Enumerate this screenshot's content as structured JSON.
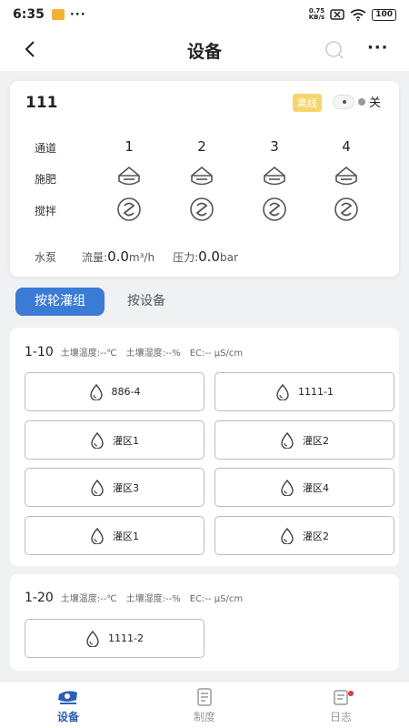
{
  "status_bar": {
    "time": "6:35",
    "dots": "···",
    "net_speed_value": "0.75",
    "net_speed_unit": "KB/s",
    "battery": "100"
  },
  "navbar": {
    "title": "设备"
  },
  "device": {
    "name": "111",
    "status_badge": "离线",
    "switch_label": "关",
    "row_labels": {
      "channel": "通道",
      "fertilize": "施肥",
      "stir": "搅拌",
      "pump": "水泵"
    },
    "channels": [
      "1",
      "2",
      "3",
      "4"
    ],
    "pump": {
      "flow_label": "流量:",
      "flow_value": "0.0",
      "flow_unit": "m³/h",
      "pressure_label": "压力:",
      "pressure_value": "0.0",
      "pressure_unit": "bar"
    }
  },
  "tabs": {
    "by_group": "按轮灌组",
    "by_device": "按设备",
    "active": "by_group"
  },
  "zone_groups": [
    {
      "name": "1-10",
      "soil_temp": "土壤温度:--℃",
      "soil_humidity": "土壤湿度:--%",
      "ec": "EC:-- μS/cm",
      "buttons": [
        "886-4",
        "1111-1",
        "灌区1",
        "灌区2",
        "灌区3",
        "灌区4",
        "灌区1",
        "灌区2"
      ]
    },
    {
      "name": "1-20",
      "soil_temp": "土壤温度:--℃",
      "soil_humidity": "土壤湿度:--%",
      "ec": "EC:-- μS/cm",
      "buttons": [
        "1111-2"
      ]
    }
  ],
  "bottom_nav": {
    "items": [
      "设备",
      "制度",
      "日志"
    ],
    "active": 0
  },
  "colors": {
    "accent": "#3a7bd5",
    "badge": "#f7d56c",
    "nav_active": "#2d5fb3",
    "notification": "#e53935"
  },
  "icons": {
    "back": "chevron-left-icon",
    "search": "search-icon",
    "more": "more-dots-icon",
    "fertilize": "fertilizer-icon",
    "stir": "stir-icon",
    "zone": "water-drop-icon"
  }
}
